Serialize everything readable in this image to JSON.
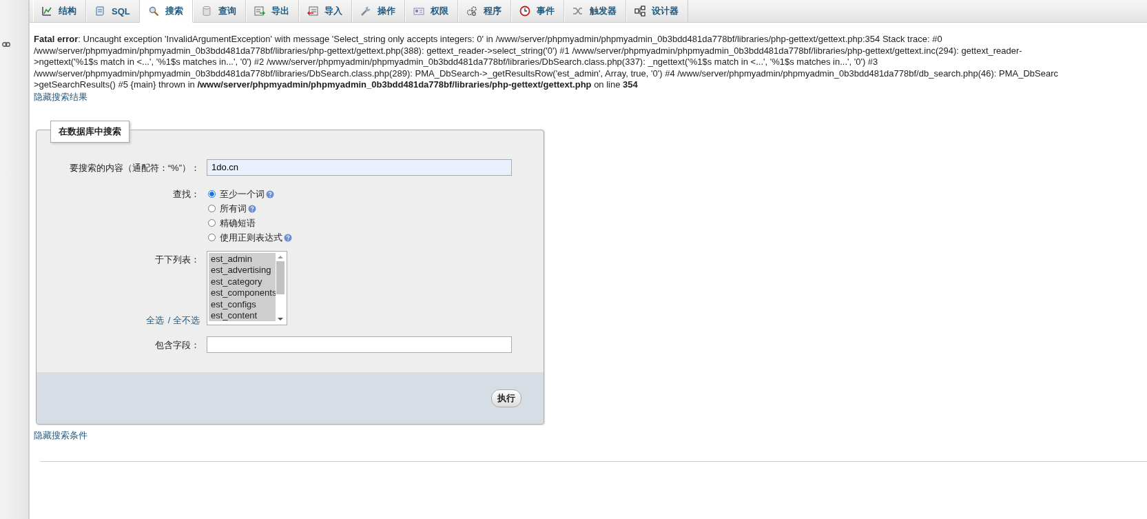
{
  "tabs": [
    {
      "label": "结构",
      "kind": "structure",
      "selected": false
    },
    {
      "label": "SQL",
      "kind": "sql",
      "selected": false
    },
    {
      "label": "搜索",
      "kind": "search",
      "selected": true
    },
    {
      "label": "查询",
      "kind": "query",
      "selected": false
    },
    {
      "label": "导出",
      "kind": "export",
      "selected": false
    },
    {
      "label": "导入",
      "kind": "import",
      "selected": false
    },
    {
      "label": "操作",
      "kind": "operations",
      "selected": false
    },
    {
      "label": "权限",
      "kind": "privileges",
      "selected": false
    },
    {
      "label": "程序",
      "kind": "routines",
      "selected": false
    },
    {
      "label": "事件",
      "kind": "events",
      "selected": false
    },
    {
      "label": "触发器",
      "kind": "triggers",
      "selected": false
    },
    {
      "label": "设计器",
      "kind": "designer",
      "selected": false
    }
  ],
  "error": {
    "lines": [
      "**Fatal error**: Uncaught exception 'InvalidArgumentException' with message 'Select_string only accepts integers: 0' in /www/server/phpmyadmin/phpmyadmin_0b3bdd481da778bf/libraries/php-gettext/gettext.php:354 Stack trace: #0",
      "/www/server/phpmyadmin/phpmyadmin_0b3bdd481da778bf/libraries/php-gettext/gettext.php(388): gettext_reader->select_string('0') #1 /www/server/phpmyadmin/phpmyadmin_0b3bdd481da778bf/libraries/php-gettext/gettext.inc(294): gettext_reader-",
      ">ngettext('%1$s match in <...', '%1$s matches in...', '0') #2 /www/server/phpmyadmin/phpmyadmin_0b3bdd481da778bf/libraries/DbSearch.class.php(337): _ngettext('%1$s match in <...', '%1$s matches in...', '0') #3",
      "/www/server/phpmyadmin/phpmyadmin_0b3bdd481da778bf/libraries/DbSearch.class.php(289): PMA_DbSearch->_getResultsRow('est_admin', Array, true, '0') #4 /www/server/phpmyadmin/phpmyadmin_0b3bdd481da778bf/db_search.php(46): PMA_DbSearc",
      ">getSearchResults() #5 {main} thrown in **/www/server/phpmyadmin/phpmyadmin_0b3bdd481da778bf/libraries/php-gettext/gettext.php** on line **354**"
    ]
  },
  "hide_results_link": "隐藏搜索结果",
  "form": {
    "legend": "在数据库中搜索",
    "search_label": "要搜索的内容（通配符：“%”）：",
    "search_value": "1do.cn",
    "find_label": "查找：",
    "options": [
      {
        "label": "至少一个词",
        "selected": true,
        "help": true
      },
      {
        "label": "所有词",
        "selected": false,
        "help": true
      },
      {
        "label": "精确短语",
        "selected": false,
        "help": false
      },
      {
        "label": "使用正则表达式",
        "selected": false,
        "help": true
      }
    ],
    "tables_label": "于下列表：",
    "tables": [
      {
        "name": "est_admin",
        "selected": true
      },
      {
        "name": "est_advertising",
        "selected": true
      },
      {
        "name": "est_category",
        "selected": true
      },
      {
        "name": "est_components",
        "selected": true
      },
      {
        "name": "est_configs",
        "selected": true
      },
      {
        "name": "est_content",
        "selected": true
      }
    ],
    "select_all": "全选",
    "select_none": "/ 全不选",
    "field_label": "包含字段：",
    "submit": "执行"
  },
  "hide_criteria_link": "隐藏搜索条件"
}
